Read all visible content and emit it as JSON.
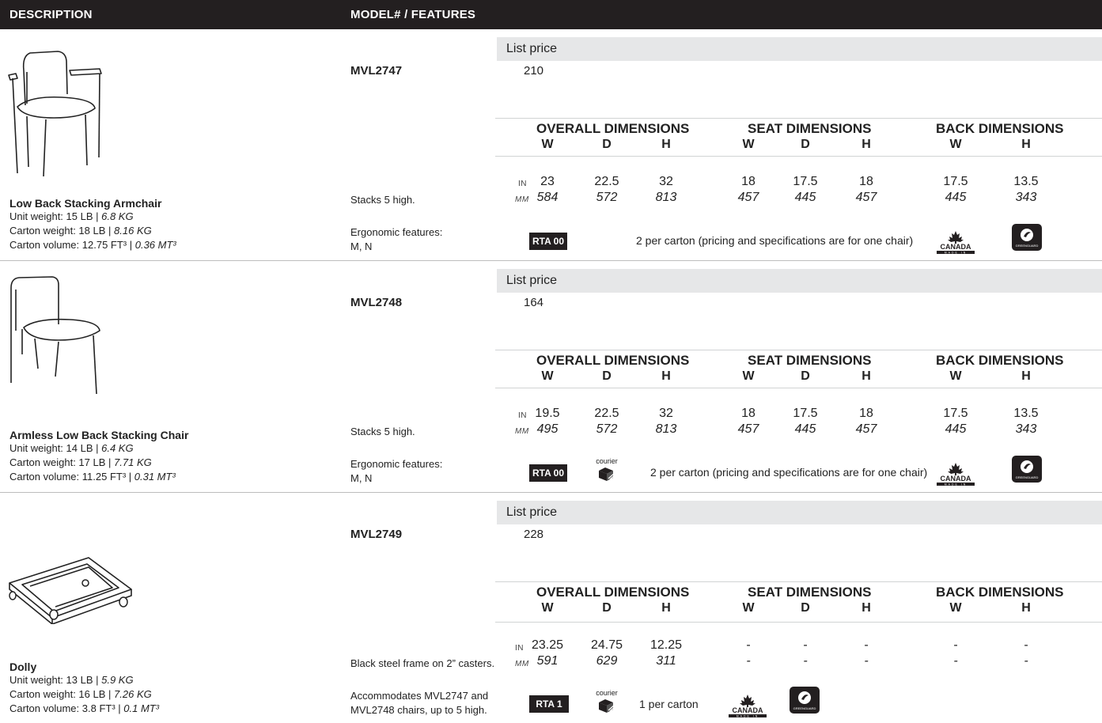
{
  "header": {
    "description": "DESCRIPTION",
    "model_features": "MODEL# / FEATURES"
  },
  "labels": {
    "list_price": "List price",
    "overall_dimensions": "OVERALL DIMENSIONS",
    "seat_dimensions": "SEAT DIMENSIONS",
    "back_dimensions": "BACK DIMENSIONS",
    "col_w": "W",
    "col_d": "D",
    "col_h": "H",
    "unit_in": "IN",
    "unit_mm": "MM",
    "courier": "courier",
    "canada": "CANADA",
    "made_in": "MADE IN",
    "greenguard": "GREENGUARD"
  },
  "products": [
    {
      "image": "low-back-stacking-armchair",
      "name": "Low Back Stacking Armchair",
      "unit_weight": "Unit weight: 15 LB |",
      "unit_weight_kg": "6.8 KG",
      "carton_weight": "Carton weight: 18 LB |",
      "carton_weight_kg": "8.16 KG",
      "carton_volume": "Carton volume: 12.75 FT³ |",
      "carton_volume_mt": "0.36 MT³",
      "model": "MVL2747",
      "price": "210",
      "in": [
        "23",
        "22.5",
        "32",
        "18",
        "17.5",
        "18",
        "17.5",
        "13.5"
      ],
      "mm": [
        "584",
        "572",
        "813",
        "457",
        "445",
        "457",
        "445",
        "343"
      ],
      "note1": "Stacks 5 high.",
      "note2": "Ergonomic features:",
      "note2b": "M, N",
      "rta": "RTA 00",
      "carton": "2 per carton (pricing and specifications are for one chair)"
    },
    {
      "image": "armless-low-back-stacking-chair",
      "name": "Armless Low Back Stacking Chair",
      "unit_weight": "Unit weight: 14 LB |",
      "unit_weight_kg": "6.4 KG",
      "carton_weight": "Carton weight: 17 LB |",
      "carton_weight_kg": "7.71 KG",
      "carton_volume": "Carton volume: 11.25 FT³ |",
      "carton_volume_mt": "0.31 MT³",
      "model": "MVL2748",
      "price": "164",
      "in": [
        "19.5",
        "22.5",
        "32",
        "18",
        "17.5",
        "18",
        "17.5",
        "13.5"
      ],
      "mm": [
        "495",
        "572",
        "813",
        "457",
        "445",
        "457",
        "445",
        "343"
      ],
      "note1": "Stacks 5 high.",
      "note2": "Ergonomic features:",
      "note2b": "M, N",
      "rta": "RTA 00",
      "carton": "2 per carton (pricing and specifications are for one chair)"
    },
    {
      "image": "dolly",
      "name": "Dolly",
      "unit_weight": "Unit weight: 13 LB |",
      "unit_weight_kg": "5.9 KG",
      "carton_weight": "Carton weight: 16 LB |",
      "carton_weight_kg": "7.26 KG",
      "carton_volume": "Carton volume: 3.8 FT³ |",
      "carton_volume_mt": "0.1 MT³",
      "model": "MVL2749",
      "price": "228",
      "in": [
        "23.25",
        "24.75",
        "12.25",
        "-",
        "-",
        "-",
        "-",
        "-"
      ],
      "mm": [
        "591",
        "629",
        "311",
        "-",
        "-",
        "-",
        "-",
        "-"
      ],
      "note1": "Black steel frame on 2” casters.",
      "note2": "Accommodates MVL2747 and",
      "note2b": "MVL2748 chairs, up to 5 high.",
      "rta": "RTA 1",
      "carton": "1 per carton"
    }
  ]
}
